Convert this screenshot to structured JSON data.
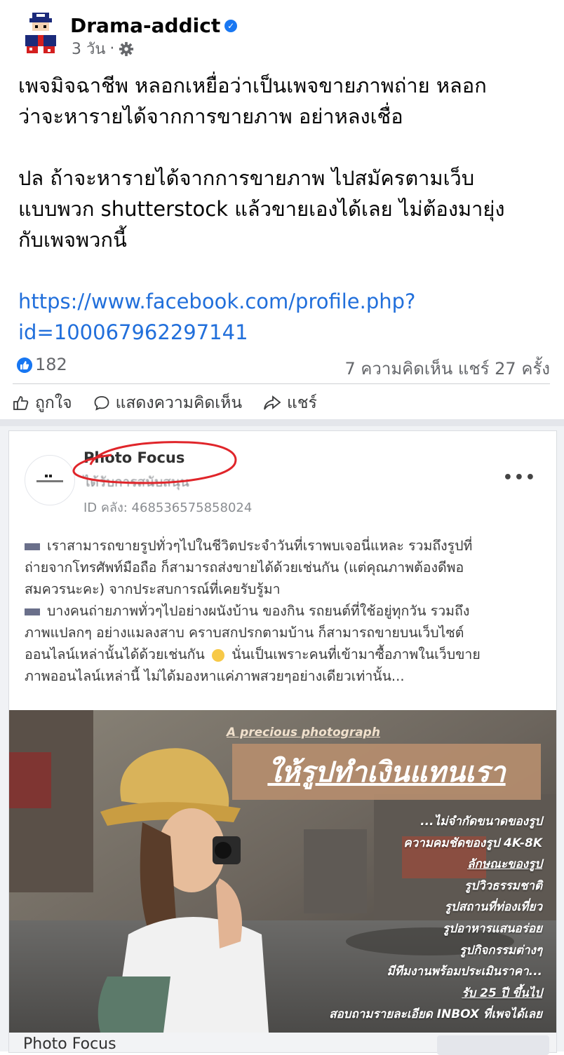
{
  "post": {
    "author": "Drama-addict",
    "time": "3 วัน",
    "separator": "·",
    "body": {
      "line1": "เพจมิจฉาชีพ หลอกเหยื่อว่าเป็นเพจขายภาพถ่าย หลอก",
      "line2": "ว่าจะหารายได้จากการขายภาพ  อย่าหลงเชื่อ",
      "line3": "ปล ถ้าจะหารายได้จากการขายภาพ ไปสมัครตามเว็บ",
      "line4": "แบบพวก shutterstock แล้วขายเองได้เลย ไม่ต้องมายุ่ง",
      "line5": "กับเพจพวกนี้",
      "link1": "https://www.facebook.com/profile.php?",
      "link2": "id=100067962297141"
    },
    "stats": {
      "likes": "182",
      "comments_shares": "7 ความคิดเห็น แชร์ 27 ครั้ง"
    },
    "actions": {
      "like": "ถูกใจ",
      "comment": "แสดงความคิดเห็น",
      "share": "แชร์"
    },
    "colors": {
      "link": "#216fdb",
      "accent": "#1877f2"
    }
  },
  "shared": {
    "page_name": "Photo Focus",
    "sponsored": "ได้รับการสนับสนุน",
    "post_id": "ID คลัง: 468536575858024",
    "more": "•••",
    "text": {
      "l1": "เราสามารถขายรูปทั่วๆไปในชีวิตประจำวันที่เราพบเจอนี่แหละ รวมถึงรูปที่",
      "l2": "ถ่ายจากโทรศัพท์มือถือ ก็สามารถส่งขายได้ด้วยเช่นกัน (แต่คุณภาพต้องดีพอ",
      "l3": "สมควรนะคะ) จากประสบการณ์ที่เคยรับรู้มา",
      "l4": "บางคนถ่ายภาพทั่วๆไปอย่างผนังบ้าน ของกิน รถยนต์ที่ใช้อยู่ทุกวัน รวมถึง",
      "l5": "ภาพแปลกๆ อย่างแมลงสาบ คราบสกปรกตามบ้าน ก็สามารถขายบนเว็บไซต์",
      "l6a": "ออนไลน์เหล่านั้นได้ด้วยเช่นกัน",
      "l6b": "นั่นเป็นเพราะคนที่เข้ามาซื้อภาพในเว็บขาย",
      "l7": "ภาพออนไลน์เหล่านี้ ไม่ได้มองหาแค่ภาพสวยๆอย่างเดียวเท่านั้น..."
    },
    "image": {
      "kicker": "A precious photograph",
      "title": "ให้รูปทำเงินแทนเรา",
      "lines": [
        "...ไม่จำกัดขนาดของรูป",
        "ความคมชัดของรูป 4K-8K",
        "ลักษณะของรูป",
        "รูปวิวธรรมชาติ",
        "รูปสถานที่ท่องเที่ยว",
        "รูปอาหารแสนอร่อย",
        "รูปกิจกรรมต่างๆ",
        "มีทีมงานพร้อมประเมินราคา...",
        "รับ 25 ปี ขึ้นไป",
        "สอบถามรายละเอียด INBOX ที่เพจได้เลย"
      ]
    },
    "footer_name": "Photo Focus"
  }
}
